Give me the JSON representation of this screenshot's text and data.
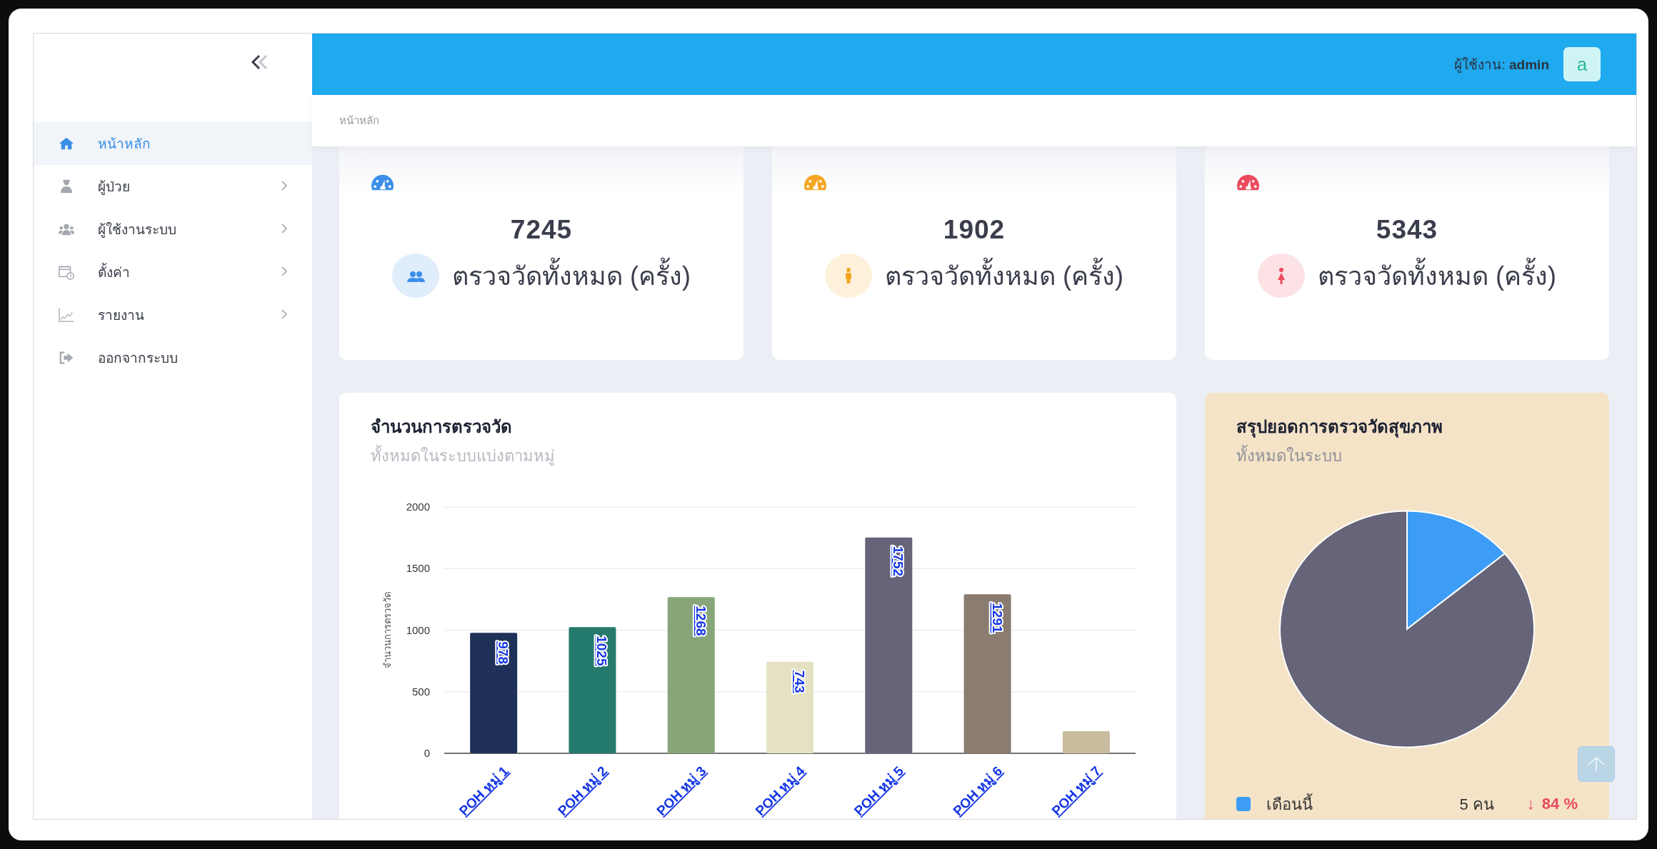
{
  "sidebar": {
    "items": [
      {
        "label": "หน้าหลัก",
        "kind": "home",
        "selected": true,
        "has_submenu": false
      },
      {
        "label": "ผู้ป่วย",
        "kind": "patient",
        "selected": false,
        "has_submenu": true
      },
      {
        "label": "ผู้ใช้งานระบบ",
        "kind": "users",
        "selected": false,
        "has_submenu": true
      },
      {
        "label": "ตั้งค่า",
        "kind": "calendar",
        "selected": false,
        "has_submenu": true
      },
      {
        "label": "รายงาน",
        "kind": "chart",
        "selected": false,
        "has_submenu": true
      },
      {
        "label": "ออกจากระบบ",
        "kind": "logout",
        "selected": false,
        "has_submenu": false
      }
    ]
  },
  "header": {
    "user_label": "ผู้ใช้งาน: **admin**",
    "avatar": "a"
  },
  "breadcrumb": "หน้าหลัก",
  "stats": [
    {
      "value": "7245",
      "label": "ตรวจวัดทั้งหมด (ครั้ง)",
      "kind": "group",
      "color": "#3b8fe8"
    },
    {
      "value": "1902",
      "label": "ตรวจวัดทั้งหมด (ครั้ง)",
      "kind": "male",
      "color": "#f5a623"
    },
    {
      "value": "5343",
      "label": "ตรวจวัดทั้งหมด (ครั้ง)",
      "kind": "female",
      "color": "#ec4a5d"
    }
  ],
  "bar_card": {
    "title": "จำนวนการตรวจวัด",
    "subtitle": "ทั้งหมดในระบบแบ่งตามหมู่",
    "chart_data": {
      "type": "bar",
      "ylabel": "จำนวนการตรวจวัด",
      "categories": [
        "POH หมู่ 1",
        "POH หมู่ 2",
        "POH หมู่ 3",
        "POH หมู่ 4",
        "POH หมู่ 5",
        "POH หมู่ 6",
        "POH หมู่ 7"
      ],
      "values": [
        978,
        1025,
        1268,
        743,
        1752,
        1291,
        180
      ],
      "colors": [
        "#1f3059",
        "#247a6c",
        "#88a57a",
        "#e5e2c4",
        "#666479",
        "#8a7c70",
        "#c8bb9e"
      ],
      "ylim": [
        0,
        2000
      ],
      "grid": true,
      "yticks": [
        0,
        500,
        1000,
        1500,
        2000
      ],
      "value_labels": [
        "978",
        "1025",
        "1268",
        "743",
        "1752",
        "1291",
        null
      ]
    }
  },
  "pie_card": {
    "title": "สรุปยอดการตรวจวัดสุขภาพ",
    "subtitle": "ทั้งหมดในระบบ",
    "legend": [
      {
        "label": "เดือนนี้",
        "count": "5 คน",
        "change": "84 %",
        "trend_arrow": "↓",
        "color": "#3d9cf5"
      }
    ]
  }
}
